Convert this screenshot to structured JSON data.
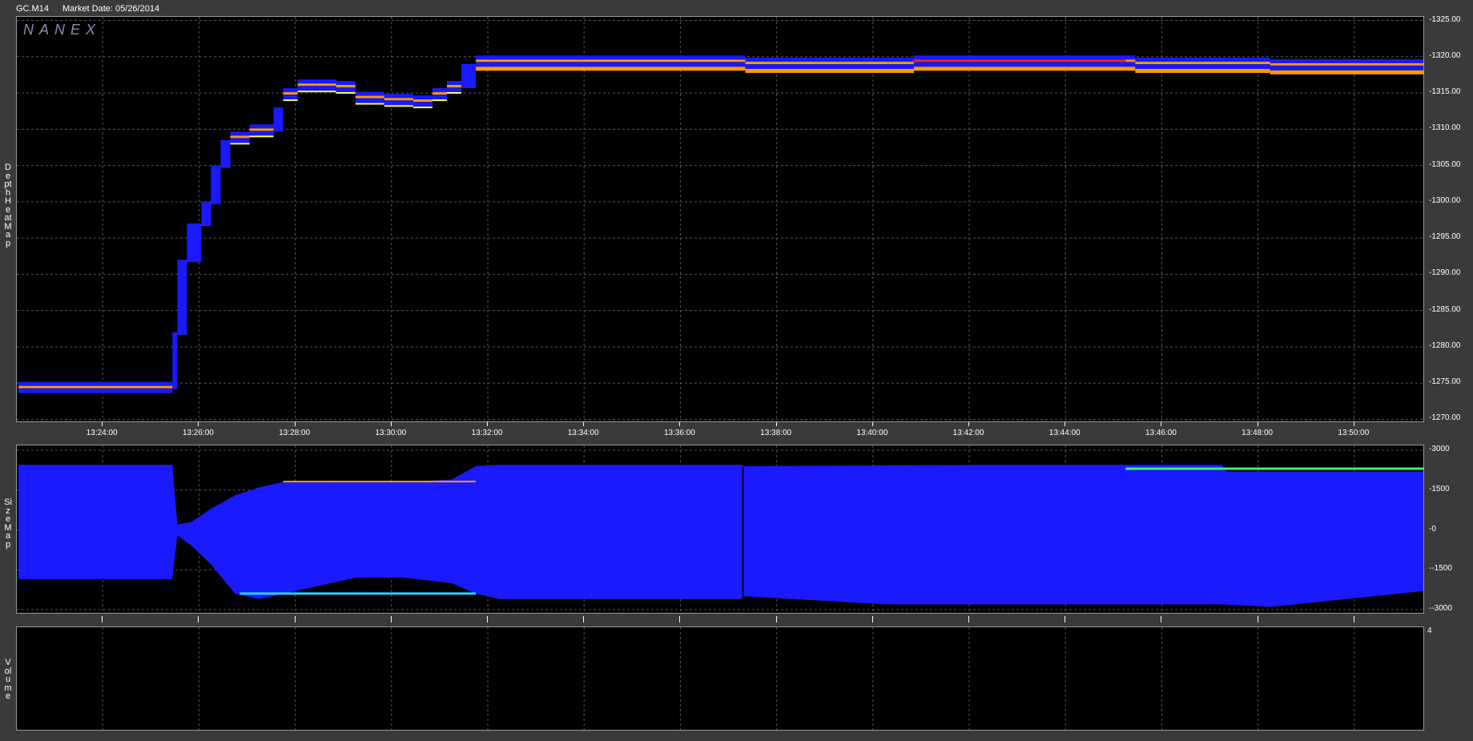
{
  "header": {
    "symbol": "GC.M14",
    "market_date": "Market Date: 05/26/2014"
  },
  "logo": "NANEX",
  "colors": {
    "background": "#000000",
    "blue": "#1a1aff",
    "orange": "#ff9900",
    "red": "#ff2020",
    "yellow": "#ffff33",
    "green": "#33ff66",
    "cyan": "#33ccff"
  },
  "chart_data": [
    {
      "type": "heatmap",
      "panel": "Depth Heat Map",
      "ylabel": "Depth Heat Map",
      "x_ticks": [
        "13:24:00",
        "13:26:00",
        "13:28:00",
        "13:30:00",
        "13:32:00",
        "13:34:00",
        "13:36:00",
        "13:38:00",
        "13:40:00",
        "13:42:00",
        "13:44:00",
        "13:46:00",
        "13:48:00",
        "13:50:00"
      ],
      "y_ticks": [
        "1325.00",
        "1320.00",
        "1315.00",
        "1310.00",
        "1305.00",
        "1300.00",
        "1295.00",
        "1290.00",
        "1285.00",
        "1280.00",
        "1275.00",
        "1270.00"
      ],
      "ylim": [
        1269.5,
        1325.5
      ],
      "xlim_minutes": [
        0,
        29.2
      ],
      "price_path": [
        [
          0,
          1274.5
        ],
        [
          3.2,
          1274.5
        ],
        [
          3.3,
          1282
        ],
        [
          3.5,
          1292
        ],
        [
          3.8,
          1297
        ],
        [
          4.0,
          1300
        ],
        [
          4.2,
          1305
        ],
        [
          4.4,
          1308.5
        ],
        [
          4.8,
          1309
        ],
        [
          5.3,
          1310
        ],
        [
          5.5,
          1313
        ],
        [
          5.8,
          1315
        ],
        [
          6.2,
          1316.2
        ],
        [
          6.6,
          1316
        ],
        [
          7.0,
          1314.5
        ],
        [
          7.6,
          1314.2
        ],
        [
          8.2,
          1312.5
        ],
        [
          8.6,
          1314
        ],
        [
          8.9,
          1315
        ],
        [
          9.2,
          1316
        ],
        [
          9.5,
          1319
        ],
        [
          9.8,
          1319.5
        ],
        [
          15,
          1319.5
        ],
        [
          15.1,
          1318.8
        ],
        [
          18.6,
          1319.2
        ],
        [
          18.8,
          1319.5
        ],
        [
          23,
          1319.5
        ],
        [
          23.2,
          1319.2
        ],
        [
          26,
          1319
        ],
        [
          29.2,
          1318.8
        ]
      ],
      "grid": true
    },
    {
      "type": "area",
      "panel": "Size Map",
      "ylabel": "Size Map",
      "y_ticks": [
        "3000",
        "1500",
        "0",
        "-1500",
        "-3000"
      ],
      "ylim": [
        -3000,
        3000
      ],
      "upper": [
        [
          0,
          2450
        ],
        [
          3.2,
          2450
        ],
        [
          3.3,
          200
        ],
        [
          3.6,
          300
        ],
        [
          4.0,
          800
        ],
        [
          4.5,
          1300
        ],
        [
          5.0,
          1600
        ],
        [
          5.5,
          1800
        ],
        [
          6.5,
          1850
        ],
        [
          8,
          1800
        ],
        [
          9,
          1900
        ],
        [
          9.5,
          2400
        ],
        [
          10,
          2450
        ],
        [
          15,
          2450
        ],
        [
          15.1,
          2400
        ],
        [
          20,
          2450
        ],
        [
          25,
          2450
        ],
        [
          25.1,
          2200
        ],
        [
          29.2,
          2200
        ]
      ],
      "lower": [
        [
          0,
          -1850
        ],
        [
          3.2,
          -1850
        ],
        [
          3.3,
          -200
        ],
        [
          3.6,
          -600
        ],
        [
          4.0,
          -1300
        ],
        [
          4.5,
          -2400
        ],
        [
          5.0,
          -2600
        ],
        [
          5.5,
          -2400
        ],
        [
          6.0,
          -2200
        ],
        [
          7,
          -1800
        ],
        [
          8,
          -1800
        ],
        [
          9,
          -2000
        ],
        [
          9.5,
          -2400
        ],
        [
          10,
          -2600
        ],
        [
          15,
          -2600
        ],
        [
          15.1,
          -2500
        ],
        [
          18,
          -2800
        ],
        [
          20,
          -2800
        ],
        [
          25,
          -2800
        ],
        [
          26,
          -2900
        ],
        [
          29.2,
          -2300
        ]
      ],
      "grid": true
    },
    {
      "type": "bar",
      "panel": "Volume",
      "ylabel": "Volume",
      "y_ticks": [
        "4"
      ],
      "values": [],
      "grid": true
    }
  ]
}
